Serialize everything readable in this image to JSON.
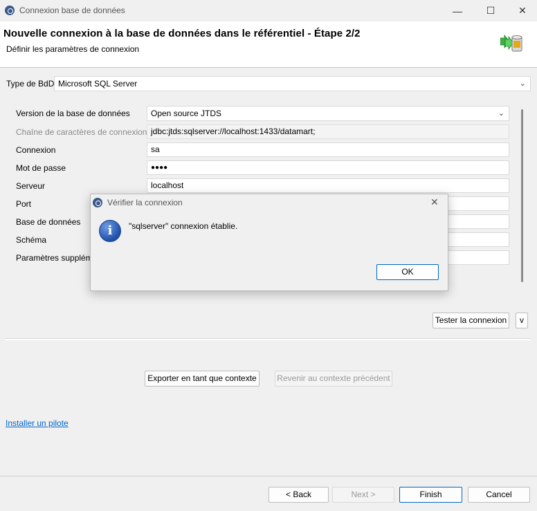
{
  "window": {
    "title": "Connexion base de données",
    "minimize": "—",
    "maximize": "☐",
    "close": "✕"
  },
  "header": {
    "title": "Nouvelle connexion à la base de données dans le référentiel - Étape 2/2",
    "subtitle": "Définir les paramètres de connexion"
  },
  "form": {
    "db_type_label": "Type de BdD",
    "db_type_value": "Microsoft SQL Server",
    "db_version_label": "Version de la base de données",
    "db_version_value": "Open source JTDS",
    "conn_string_label": "Chaîne de caractères de connexion",
    "conn_string_value": "jdbc:jtds:sqlserver://localhost:1433/datamart;",
    "login_label": "Connexion",
    "login_value": "sa",
    "password_label": "Mot de passe",
    "password_value": "●●●●",
    "server_label": "Serveur",
    "server_value": "localhost",
    "port_label": "Port",
    "database_label": "Base de données",
    "schema_label": "Schéma",
    "params_label": "Paramètres supplém"
  },
  "buttons": {
    "test_connection": "Tester la connexion",
    "toggle": "v",
    "export_context": "Exporter en tant que contexte",
    "revert_context": "Revenir au contexte précédent",
    "back": "< Back",
    "next": "Next >",
    "finish": "Finish",
    "cancel": "Cancel"
  },
  "links": {
    "install_driver": "Installer un pilote"
  },
  "dialog": {
    "title": "Vérifier la connexion",
    "message": "\"sqlserver\" connexion établie.",
    "ok": "OK",
    "close": "✕",
    "info_glyph": "i"
  }
}
